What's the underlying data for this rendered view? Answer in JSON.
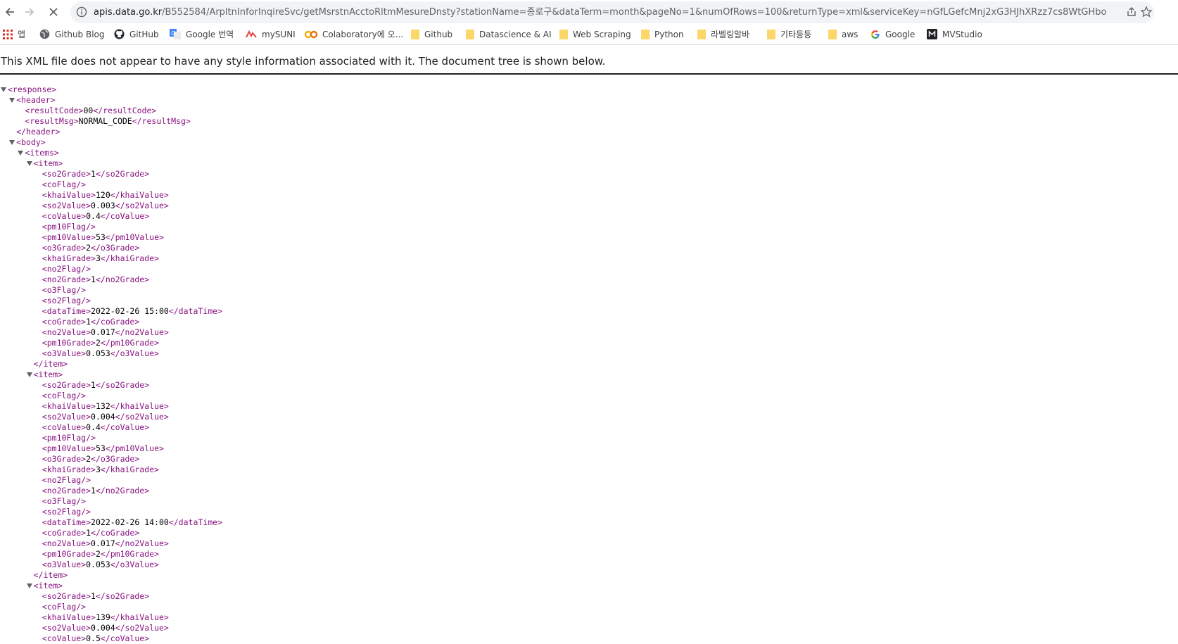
{
  "browser": {
    "url_domain": "apis.data.go.kr",
    "url_rest": "/B552584/ArpltnInforInqireSvc/getMsrstnAcctoRltmMesureDnsty?stationName=종로구&dataTerm=month&pageNo=1&numOfRows=100&returnType=xml&serviceKey=nGfLGefcMnj2xG3HJhXRzz7cs8WtGHbodAmkFL..."
  },
  "bookmarks": [
    {
      "label": "앱",
      "icon": "apps-grid-icon"
    },
    {
      "label": "Github Blog",
      "icon": "globe-icon"
    },
    {
      "label": "GitHub",
      "icon": "github-icon"
    },
    {
      "label": "Google 번역",
      "icon": "google-translate-icon"
    },
    {
      "label": "mySUNI",
      "icon": "mysuni-icon"
    },
    {
      "label": "Colaboratory에 오...",
      "icon": "colab-icon"
    },
    {
      "label": "Github",
      "icon": "folder-icon"
    },
    {
      "label": "Datascience & AI",
      "icon": "folder-icon"
    },
    {
      "label": "Web Scraping",
      "icon": "folder-icon"
    },
    {
      "label": "Python",
      "icon": "folder-icon"
    },
    {
      "label": "라벨링알바",
      "icon": "folder-icon"
    },
    {
      "label": "기타등등",
      "icon": "folder-icon"
    },
    {
      "label": "aws",
      "icon": "folder-icon"
    },
    {
      "label": "Google",
      "icon": "google-icon"
    },
    {
      "label": "MVStudio",
      "icon": "mvstudio-icon"
    }
  ],
  "xml_info": "This XML file does not appear to have any style information associated with it. The document tree is shown below.",
  "xml": {
    "resultCode": "00",
    "resultMsg": "NORMAL_CODE",
    "items": [
      {
        "so2Grade": "1",
        "khaiValue": "120",
        "so2Value": "0.003",
        "coValue": "0.4",
        "pm10Value": "53",
        "o3Grade": "2",
        "khaiGrade": "3",
        "no2Grade": "1",
        "dataTime": "2022-02-26 15:00",
        "coGrade": "1",
        "no2Value": "0.017",
        "pm10Grade": "2",
        "o3Value": "0.053"
      },
      {
        "so2Grade": "1",
        "khaiValue": "132",
        "so2Value": "0.004",
        "coValue": "0.4",
        "pm10Value": "53",
        "o3Grade": "2",
        "khaiGrade": "3",
        "no2Grade": "1",
        "dataTime": "2022-02-26 14:00",
        "coGrade": "1",
        "no2Value": "0.017",
        "pm10Grade": "2",
        "o3Value": "0.053"
      },
      {
        "so2Grade": "1",
        "khaiValue": "139",
        "so2Value": "0.004",
        "coValue": "0.5"
      }
    ]
  }
}
